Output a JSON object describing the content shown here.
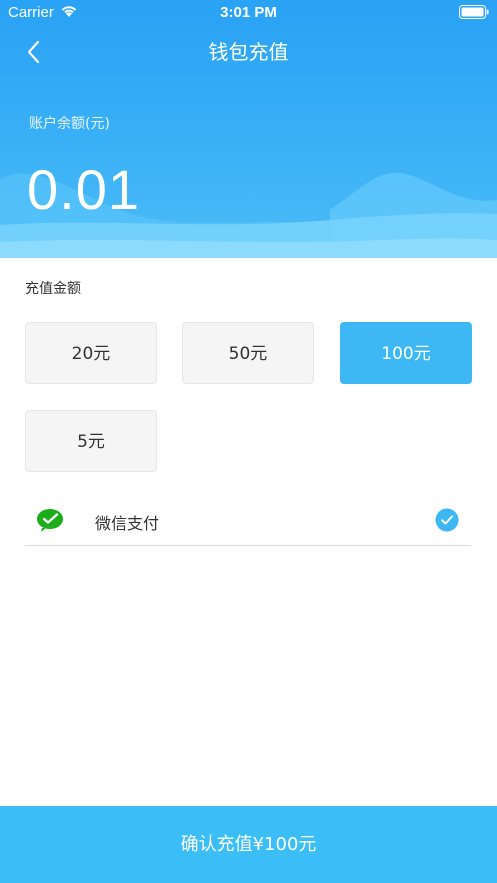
{
  "status_bar": {
    "carrier": "Carrier",
    "time": "3:01 PM"
  },
  "nav": {
    "title": "钱包充值",
    "back_icon": "chevron-left-icon"
  },
  "balance": {
    "label": "账户余额(元)",
    "value": "0.01"
  },
  "recharge": {
    "section_title": "充值金额",
    "options": [
      {
        "label": "20元",
        "selected": false
      },
      {
        "label": "50元",
        "selected": false
      },
      {
        "label": "100元",
        "selected": true
      },
      {
        "label": "5元",
        "selected": false
      }
    ]
  },
  "payment": {
    "method_label": "微信支付",
    "icon": "wechat-pay-icon",
    "checked": true
  },
  "confirm": {
    "label": "确认充值¥100元"
  },
  "colors": {
    "accent": "#3db8f5",
    "header": "#2aa2f5",
    "button": "#3bbdf7"
  }
}
